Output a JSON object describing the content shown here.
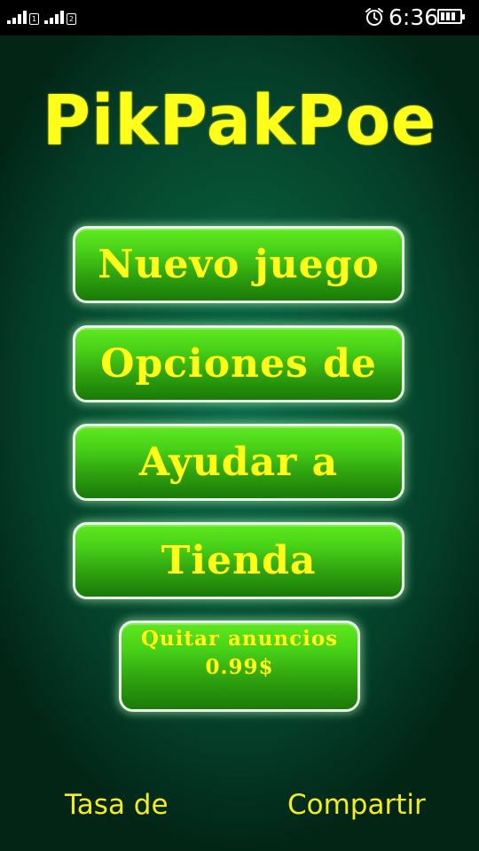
{
  "status_bar": {
    "sim1_label": "1",
    "sim2_label": "2",
    "time": "6:36",
    "icons": [
      "signal-icon",
      "signal-icon",
      "alarm-icon",
      "battery-icon"
    ]
  },
  "app": {
    "title": "PikPakPoe",
    "buttons": {
      "new_game": "Nuevo juego",
      "options": "Opciones de",
      "help": "Ayudar a",
      "shop": "Tienda",
      "remove_ads": "Quitar anuncios\n0.99$"
    },
    "footer": {
      "rate": "Tasa de",
      "share": "Compartir"
    }
  },
  "colors": {
    "accent_text": "#ffff1a",
    "button_green": "#48d218",
    "background": "#075637"
  }
}
